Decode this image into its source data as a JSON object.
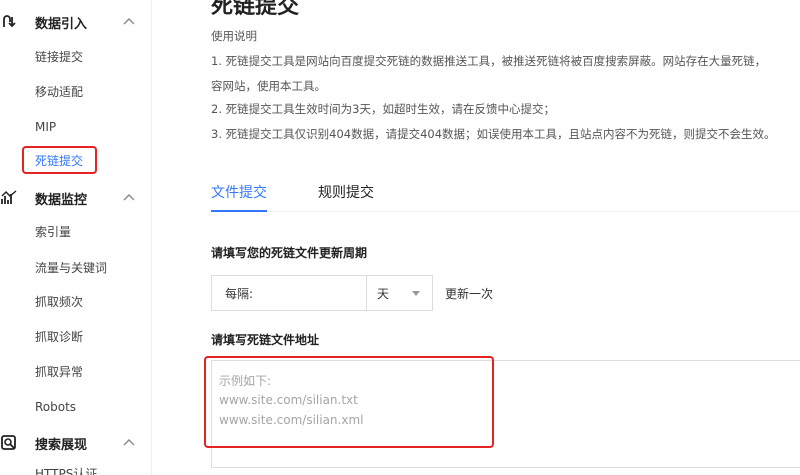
{
  "sidebar": {
    "groups": [
      {
        "label": "数据引入",
        "icon": "data-import-icon"
      },
      {
        "label": "数据监控",
        "icon": "data-monitor-icon"
      },
      {
        "label": "搜索展现",
        "icon": "search-display-icon"
      }
    ],
    "import_items": [
      "链接提交",
      "移动适配",
      "MIP",
      "死链提交"
    ],
    "monitor_items": [
      "索引量",
      "流量与关键词",
      "抓取频次",
      "抓取诊断",
      "抓取异常",
      "Robots"
    ],
    "display_items": [
      "HTTPS认证"
    ],
    "active_item": "死链提交"
  },
  "main": {
    "title": "死链提交",
    "usage_title": "使用说明",
    "usage_lines": [
      "1. 死链提交工具是网站向百度提交死链的数据推送工具，被推送死链将被百度搜索屏蔽。网站存在大量死链，",
      "容网站，使用本工具。",
      "2. 死链提交工具生效时间为3天，如超时生效，请在反馈中心提交；",
      "3. 死链提交工具仅识别404数据，请提交404数据；如误使用本工具，且站点内容不为死链，则提交不会生效。"
    ],
    "tabs": [
      "文件提交",
      "规则提交"
    ],
    "period_section_label": "请填写您的死链文件更新周期",
    "period_prefix": "每隔:",
    "period_unit": "天",
    "period_suffix": "更新一次",
    "address_section_label": "请填写死链文件地址",
    "placeholder_lines": [
      "示例如下:",
      "www.site.com/silian.txt",
      "www.site.com/silian.xml"
    ]
  },
  "colors": {
    "accent": "#3377ff",
    "highlight_border": "#e62222"
  }
}
